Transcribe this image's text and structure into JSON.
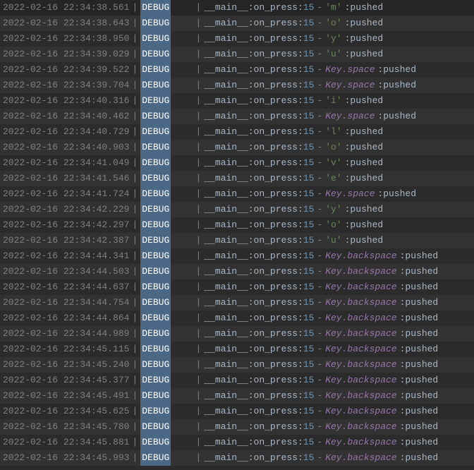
{
  "date": "2022-02-16",
  "module": "__main__",
  "func": "on_press",
  "lineno": "15",
  "level": "DEBUG",
  "pushed": ":pushed",
  "lines": [
    {
      "time": "22:34:38.561",
      "key": "'m'",
      "special": false
    },
    {
      "time": "22:34:38.643",
      "key": "'o'",
      "special": false
    },
    {
      "time": "22:34:38.950",
      "key": "'y'",
      "special": false
    },
    {
      "time": "22:34:39.029",
      "key": "'u'",
      "special": false
    },
    {
      "time": "22:34:39.522",
      "key": "Key.space",
      "special": true
    },
    {
      "time": "22:34:39.704",
      "key": "Key.space",
      "special": true
    },
    {
      "time": "22:34:40.316",
      "key": "'i'",
      "special": false
    },
    {
      "time": "22:34:40.462",
      "key": "Key.space",
      "special": true
    },
    {
      "time": "22:34:40.729",
      "key": "'l'",
      "special": false
    },
    {
      "time": "22:34:40.903",
      "key": "'o'",
      "special": false
    },
    {
      "time": "22:34:41.049",
      "key": "'v'",
      "special": false
    },
    {
      "time": "22:34:41.546",
      "key": "'e'",
      "special": false
    },
    {
      "time": "22:34:41.724",
      "key": "Key.space",
      "special": true
    },
    {
      "time": "22:34:42.229",
      "key": "'y'",
      "special": false
    },
    {
      "time": "22:34:42.297",
      "key": "'o'",
      "special": false
    },
    {
      "time": "22:34:42.387",
      "key": "'u'",
      "special": false
    },
    {
      "time": "22:34:44.341",
      "key": "Key.backspace",
      "special": true
    },
    {
      "time": "22:34:44.503",
      "key": "Key.backspace",
      "special": true
    },
    {
      "time": "22:34:44.637",
      "key": "Key.backspace",
      "special": true
    },
    {
      "time": "22:34:44.754",
      "key": "Key.backspace",
      "special": true
    },
    {
      "time": "22:34:44.864",
      "key": "Key.backspace",
      "special": true
    },
    {
      "time": "22:34:44.989",
      "key": "Key.backspace",
      "special": true
    },
    {
      "time": "22:34:45.115",
      "key": "Key.backspace",
      "special": true
    },
    {
      "time": "22:34:45.240",
      "key": "Key.backspace",
      "special": true
    },
    {
      "time": "22:34:45.377",
      "key": "Key.backspace",
      "special": true
    },
    {
      "time": "22:34:45.491",
      "key": "Key.backspace",
      "special": true
    },
    {
      "time": "22:34:45.625",
      "key": "Key.backspace",
      "special": true
    },
    {
      "time": "22:34:45.780",
      "key": "Key.backspace",
      "special": true
    },
    {
      "time": "22:34:45.881",
      "key": "Key.backspace",
      "special": true
    },
    {
      "time": "22:34:45.993",
      "key": "Key.backspace",
      "special": true
    }
  ]
}
